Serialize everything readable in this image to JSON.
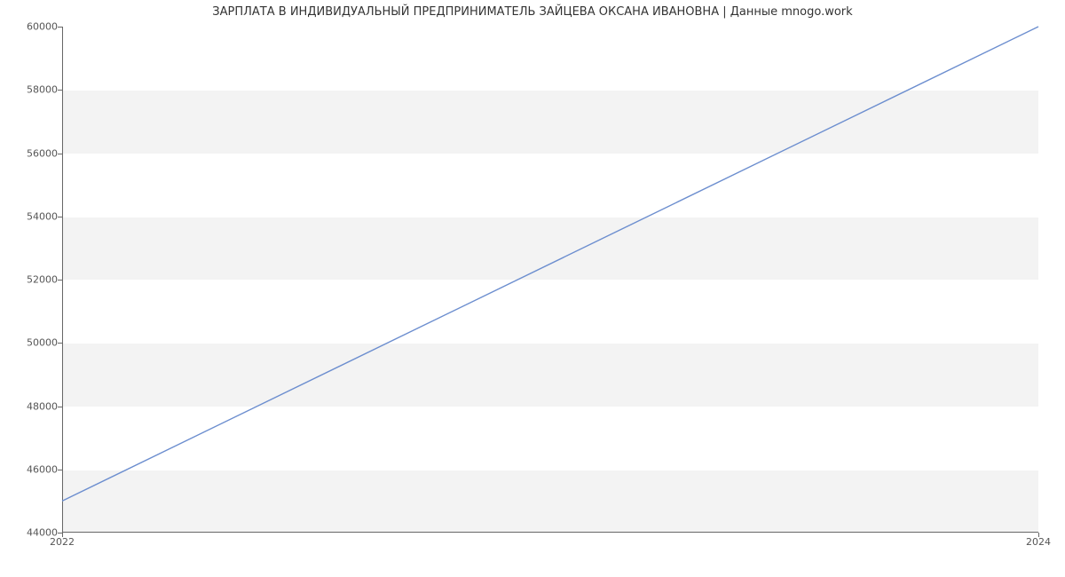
{
  "chart_data": {
    "type": "line",
    "title": "ЗАРПЛАТА В ИНДИВИДУАЛЬНЫЙ ПРЕДПРИНИМАТЕЛЬ ЗАЙЦЕВА ОКСАНА ИВАНОВНА | Данные mnogo.work",
    "xlabel": "",
    "ylabel": "",
    "x": [
      2022,
      2024
    ],
    "values": [
      45000,
      60000
    ],
    "xlim": [
      2022,
      2024
    ],
    "ylim": [
      44000,
      60000
    ],
    "yticks": [
      44000,
      46000,
      48000,
      50000,
      52000,
      54000,
      56000,
      58000,
      60000
    ],
    "xticks": [
      2022,
      2024
    ],
    "line_color": "#6c8ecf",
    "grid": true
  }
}
